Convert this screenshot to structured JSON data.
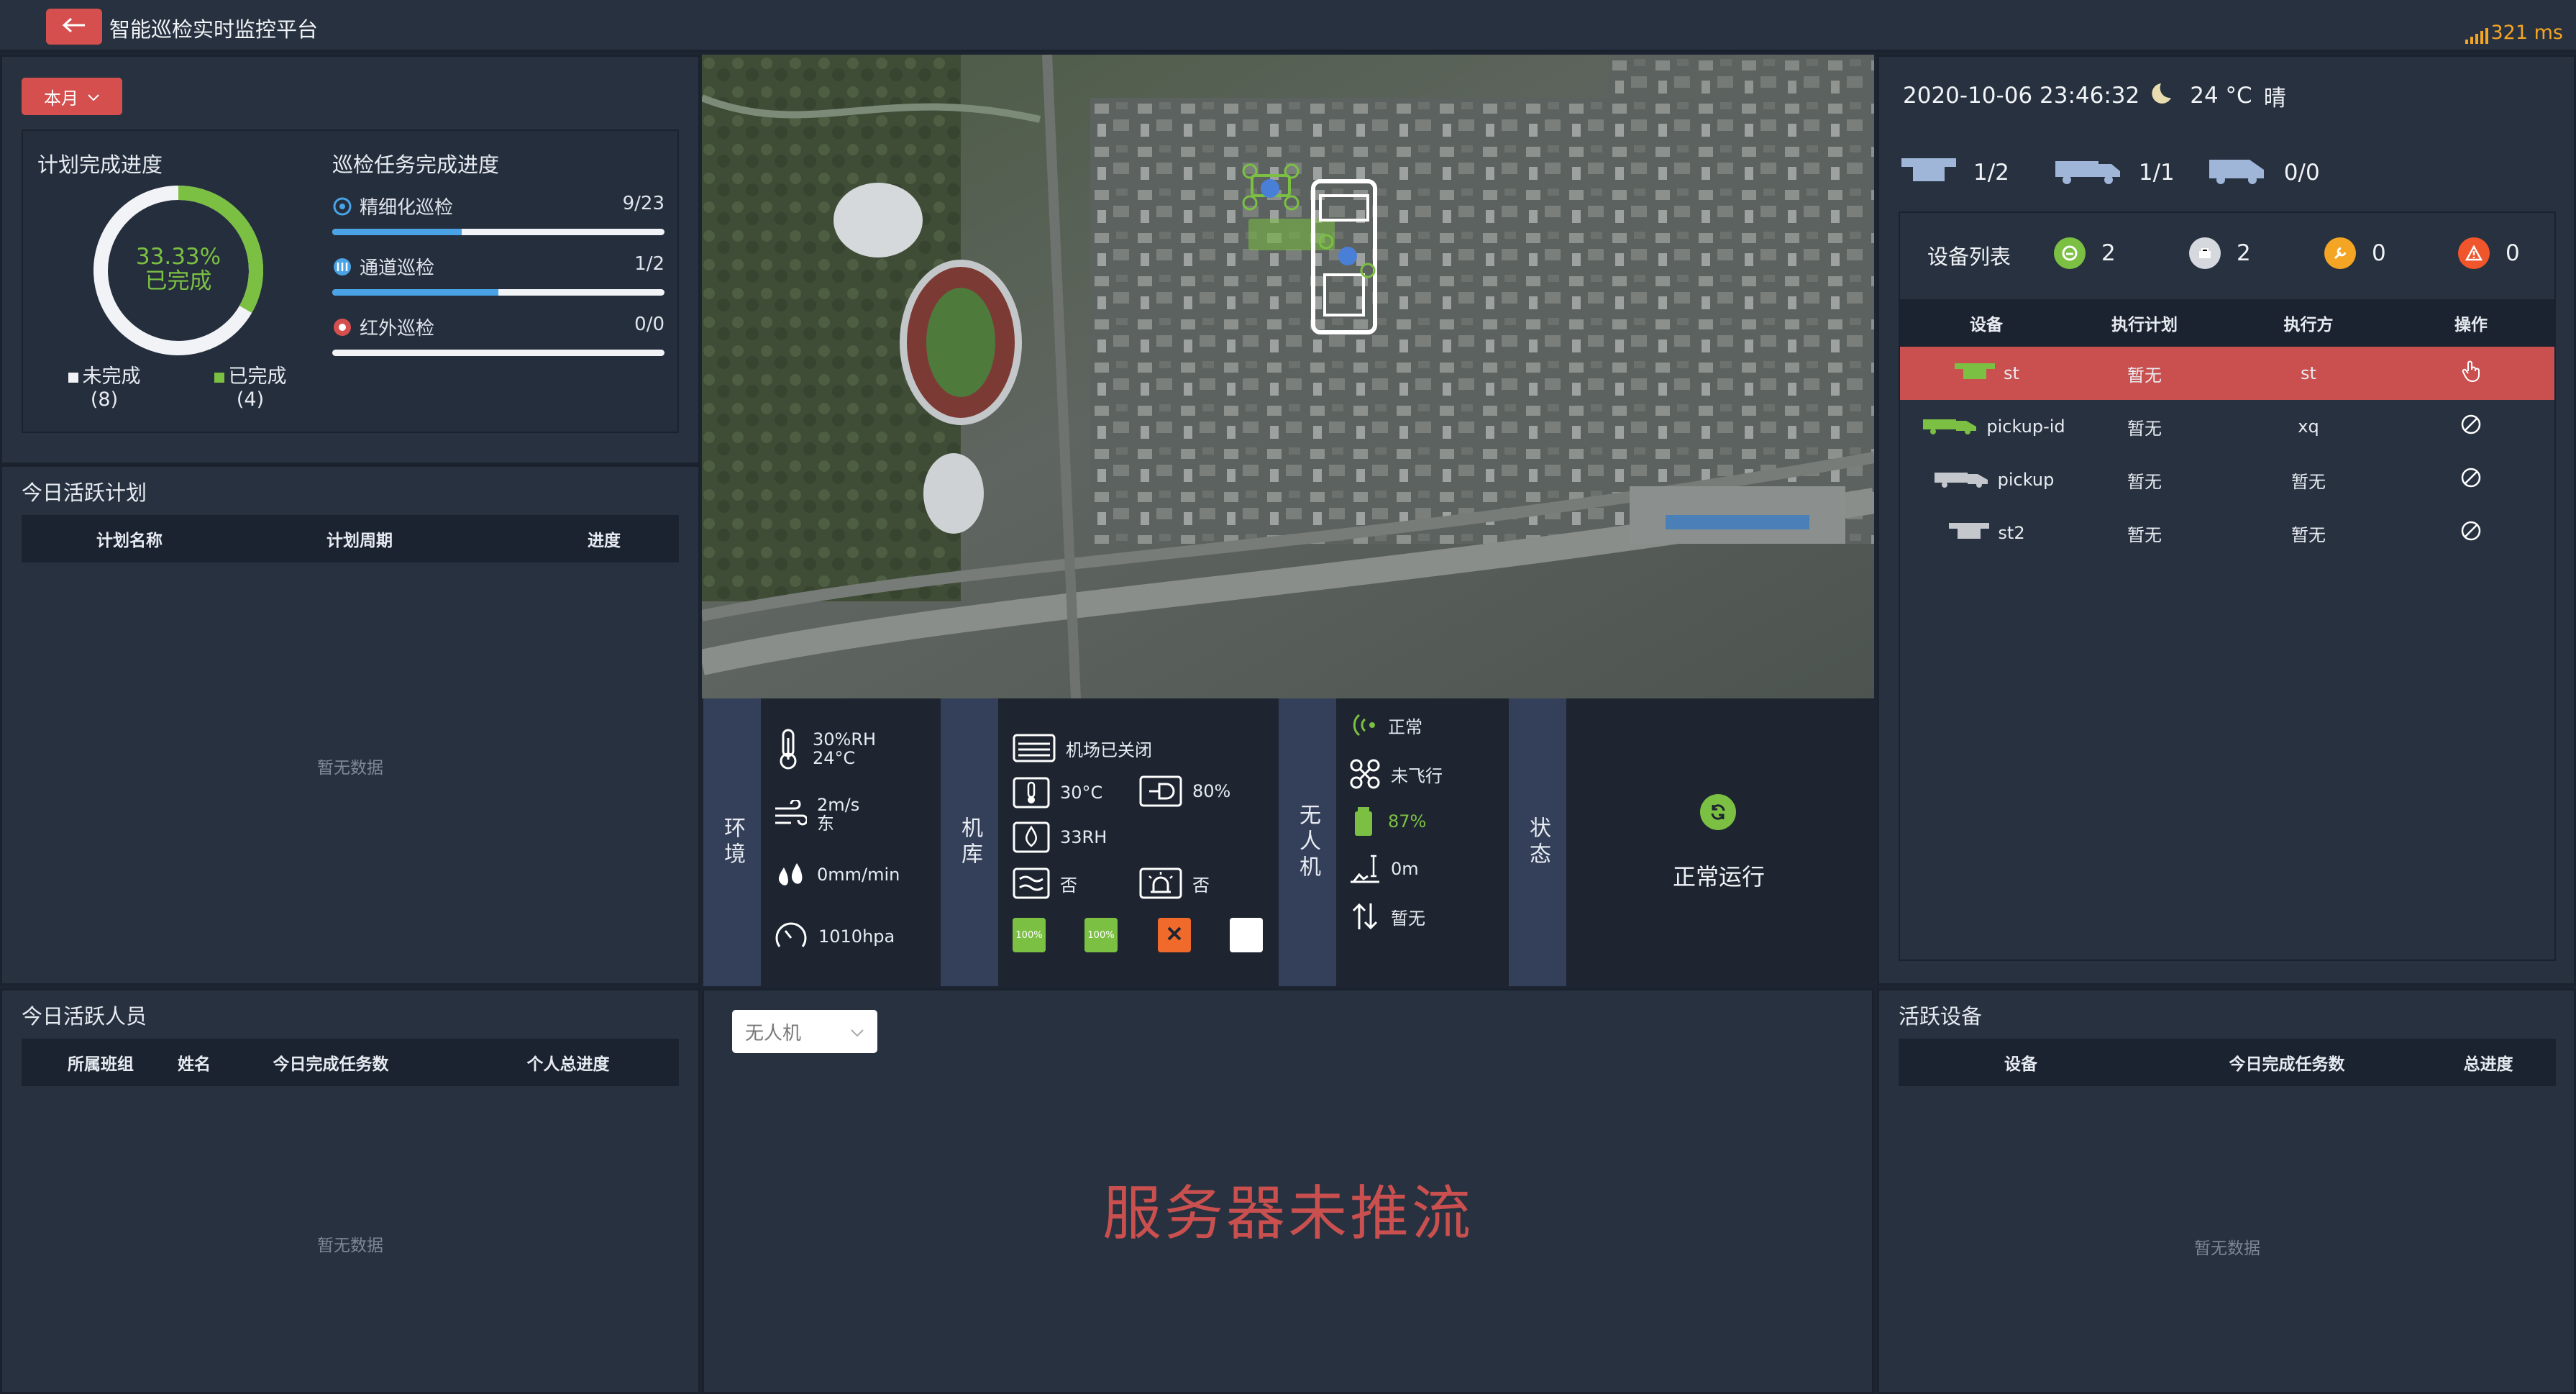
{
  "header": {
    "title": "智能巡检实时监控平台",
    "ping": "321 ms"
  },
  "plan": {
    "period_select": "本月",
    "completion_title": "计划完成进度",
    "percent": "33.33%",
    "percent_label": "已完成",
    "completed_fraction": 0.3333,
    "legend": [
      {
        "label": "未完成",
        "count": "(8)",
        "color": "#f1f3f6"
      },
      {
        "label": "已完成",
        "count": "(4)",
        "color": "#7bc043"
      }
    ],
    "task_title": "巡检任务完成进度",
    "tasks": [
      {
        "label": "精细化巡检",
        "value": "9/23",
        "progress": 0.39
      },
      {
        "label": "通道巡检",
        "value": "1/2",
        "progress": 0.5
      },
      {
        "label": "红外巡检",
        "value": "0/0",
        "progress": 0
      }
    ]
  },
  "today_plans": {
    "title": "今日活跃计划",
    "columns": [
      "计划名称",
      "计划周期",
      "进度"
    ],
    "empty": "暂无数据"
  },
  "today_people": {
    "title": "今日活跃人员",
    "columns": [
      "所属班组",
      "姓名",
      "今日完成任务数",
      "个人总进度"
    ],
    "empty": "暂无数据"
  },
  "env": {
    "label": "环境",
    "humidity": "30%RH",
    "temperature": "24°C",
    "wind_speed": "2m/s",
    "wind_dir": "东",
    "rain": "0mm/min",
    "pressure": "1010hpa"
  },
  "hangar": {
    "label": "机库",
    "door": "机场已关闭",
    "temperature": "30°C",
    "charge": "80%",
    "humidity": "33RH",
    "flag_a": "否",
    "flag_b": "否",
    "batteries": [
      {
        "text": "100%",
        "color": "#7bc043"
      },
      {
        "text": "100%",
        "color": "#7bc043"
      },
      {
        "text": "",
        "color": "#f06a2b"
      },
      {
        "text": "",
        "color": "#ffffff"
      }
    ]
  },
  "drone": {
    "label": "无人机",
    "signal": "正常",
    "flight": "未飞行",
    "battery": "87%",
    "altitude": "0m",
    "speed": "暂无"
  },
  "state": {
    "label": "状态",
    "text": "正常运行"
  },
  "right": {
    "datetime": "2020-10-06 23:46:32",
    "weather_temp": "24 °C",
    "weather": "晴",
    "counts": [
      "1/2",
      "1/1",
      "0/0"
    ],
    "device_list_title": "设备列表",
    "statuses": [
      {
        "count": "2",
        "color": "#7bc043"
      },
      {
        "count": "2",
        "color": "#d5d8dd"
      },
      {
        "count": "0",
        "color": "#f5a524"
      },
      {
        "count": "0",
        "color": "#f0552b"
      }
    ],
    "columns": [
      "设备",
      "执行计划",
      "执行方",
      "操作"
    ],
    "rows": [
      {
        "device": "st",
        "plan": "暂无",
        "executor": "st",
        "icon": "drone-icon"
      },
      {
        "device": "pickup-id",
        "plan": "暂无",
        "executor": "xq",
        "icon": "pickup-truck-icon"
      },
      {
        "device": "pickup",
        "plan": "暂无",
        "executor": "暂无",
        "icon": "pickup-truck-icon"
      },
      {
        "device": "st2",
        "plan": "暂无",
        "executor": "暂无",
        "icon": "drone-icon"
      }
    ]
  },
  "video": {
    "select": "无人机",
    "message": "服务器未推流"
  },
  "active_devices": {
    "title": "活跃设备",
    "columns": [
      "设备",
      "今日完成任务数",
      "总进度"
    ],
    "empty": "暂无数据"
  }
}
